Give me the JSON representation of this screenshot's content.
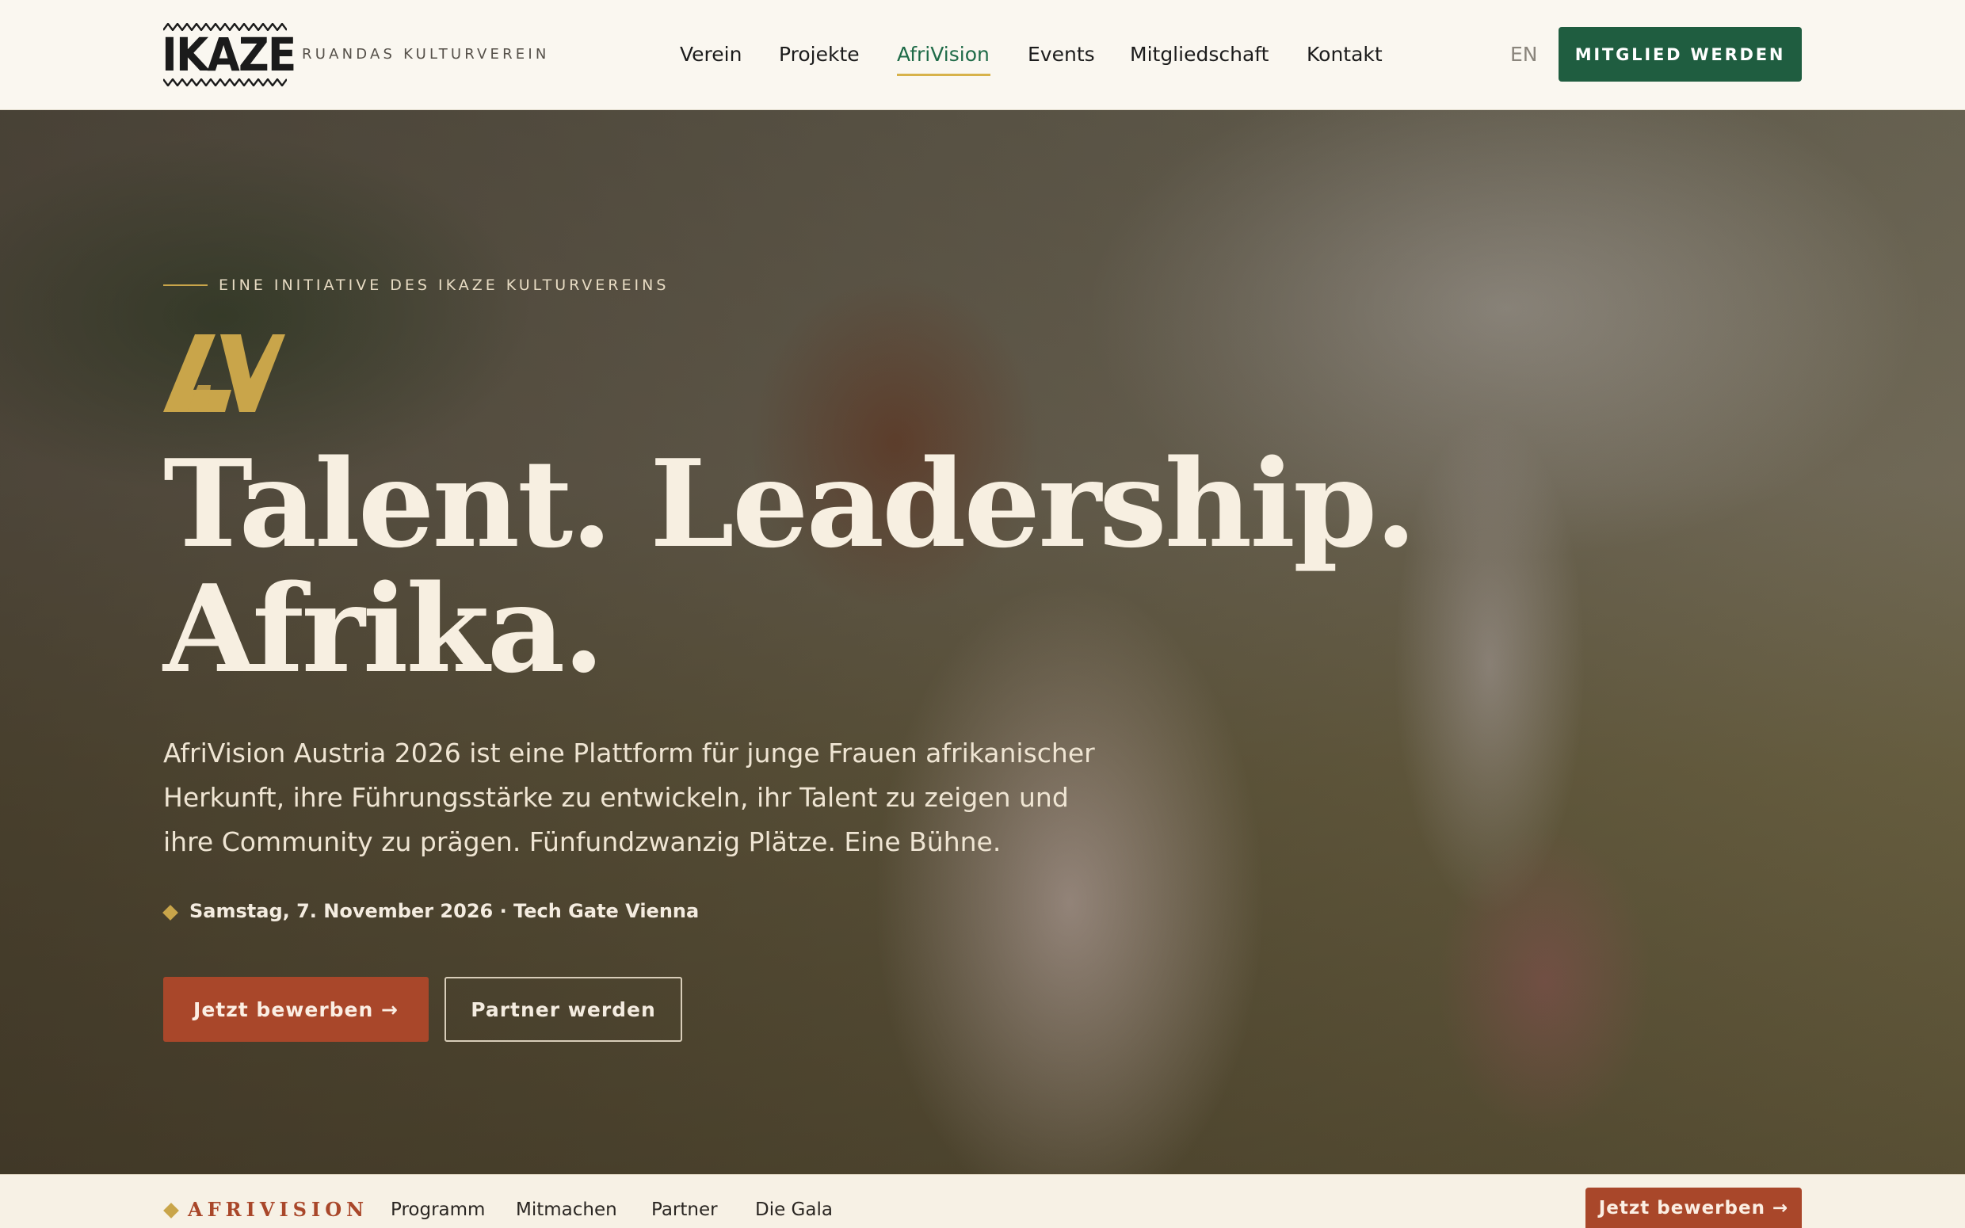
{
  "header": {
    "logo_text": "IKAZE",
    "tagline": "RUANDAS KULTURVEREIN",
    "nav": [
      {
        "label": "Verein"
      },
      {
        "label": "Projekte"
      },
      {
        "label": "AfriVision"
      },
      {
        "label": "Events"
      },
      {
        "label": "Mitgliedschaft"
      },
      {
        "label": "Kontakt"
      }
    ],
    "active_nav": "AfriVision",
    "language": "EN",
    "cta": "MITGLIED WERDEN"
  },
  "hero": {
    "eyebrow": "EINE INITIATIVE DES IKAZE KULTURVEREINS",
    "logo_mark": "AV",
    "headline_line1": "Talent. Leadership.",
    "headline_line2": "Afrika.",
    "lead": "AfriVision Austria 2026 ist eine Plattform für junge Frauen afrikanischer Herkunft, ihre Führungsstärke zu entwickeln, ihr Talent zu zeigen und ihre Community zu prägen. Fünfundzwanzig Plätze. Eine Bühne.",
    "event_info": "Samstag, 7. November 2026 · Tech Gate Vienna",
    "primary_button": "Jetzt bewerben  →",
    "secondary_button": "Partner werden"
  },
  "subnav": {
    "brand": "AFRIVISION",
    "items": [
      {
        "label": "Programm"
      },
      {
        "label": "Mitmachen"
      },
      {
        "label": "Partner"
      },
      {
        "label": "Die Gala"
      }
    ],
    "cta": "Jetzt bewerben →"
  },
  "colors": {
    "brand_green": "#1f5d40",
    "accent_rust": "#a9472a",
    "accent_gold": "#c9a54a",
    "background_cream": "#faf7f0"
  }
}
